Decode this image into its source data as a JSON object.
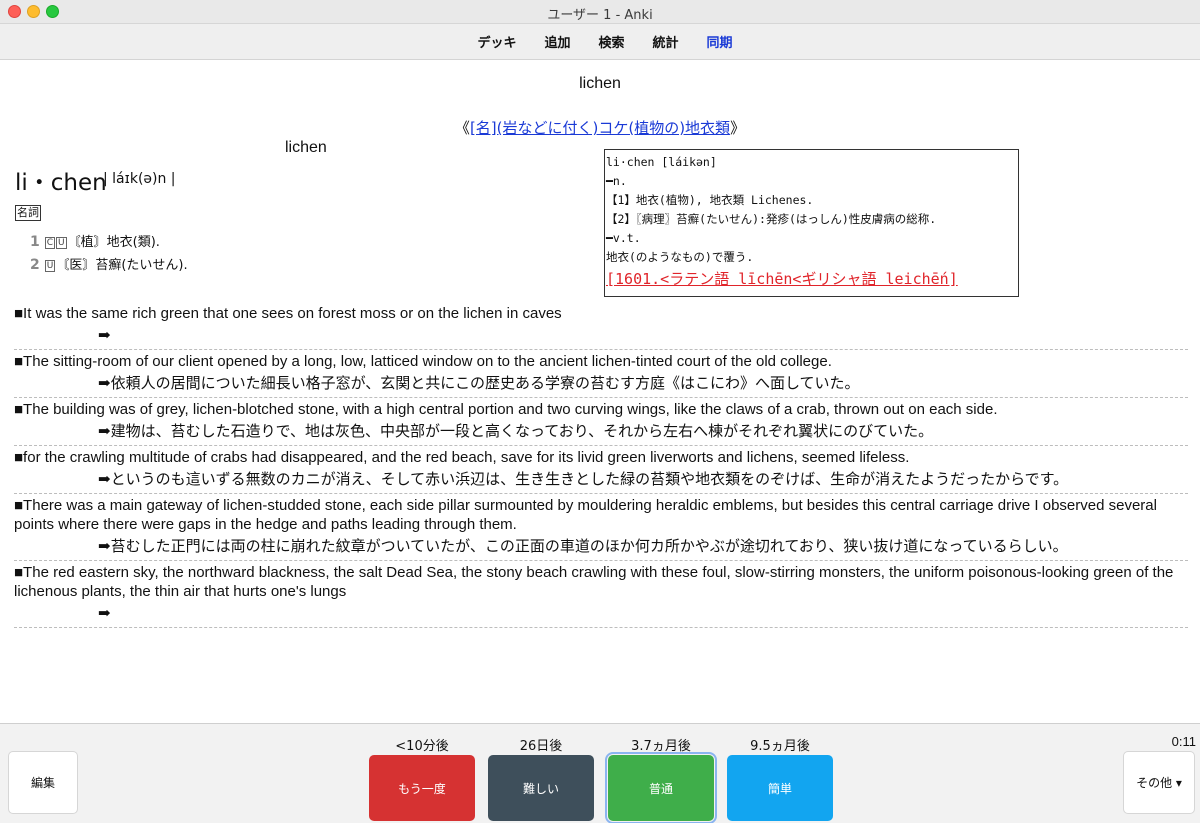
{
  "window": {
    "title": "ユーザー 1 - Anki"
  },
  "toolbar": {
    "decks": "デッキ",
    "add": "追加",
    "browse": "検索",
    "stats": "統計",
    "sync": "同期",
    "sync_color": "#1a3ad6"
  },
  "card": {
    "front": "lichen",
    "headline_open": "《",
    "headline_link": "[名](岩などに付く)コケ(植物の)地衣類",
    "headline_close": "》",
    "word_small": "lichen",
    "word_big": "li・chen",
    "pronunciation": "| láɪk(ə)n |",
    "pos": "名詞",
    "senses": [
      {
        "num": "1",
        "tags": [
          "C",
          "U"
        ],
        "text": "〘植〙地衣(類)."
      },
      {
        "num": "2",
        "tags": [
          "U"
        ],
        "text": "〘医〙苔癬(たいせん)."
      }
    ],
    "dict_lines": [
      "li·chen [láikən]",
      "━n.",
      "【1】地衣(植物), 地衣類 Lichenes.",
      "【2】〖病理〗苔癬(たいせん):発疹(はっしん)性皮膚病の総称.",
      "━v.t.",
      "地衣(のようなもの)で覆う."
    ],
    "dict_etymology": "[1601.<ラテン語 līchēn<ギリシャ語 leichḗn]",
    "dict_etymology_color": "#e0242a",
    "examples": [
      {
        "en": "■It was the same rich green that one sees on forest moss or on the lichen in caves",
        "ja": "➡"
      },
      {
        "en": "■The sitting-room of our client opened by a long, low, latticed window on to the ancient lichen-tinted court of the old college.",
        "ja": "➡依頼人の居間についた細長い格子窓が、玄関と共にこの歴史ある学寮の苔むす方庭《はこにわ》へ面していた。"
      },
      {
        "en": "■The building was of grey, lichen-blotched stone, with a high central portion and two curving wings, like the claws of a crab, thrown out on each side.",
        "ja": "➡建物は、苔むした石造りで、地は灰色、中央部が一段と高くなっており、それから左右へ棟がそれぞれ翼状にのびていた。"
      },
      {
        "en": "■for the crawling multitude of crabs had disappeared, and the red beach, save for its livid green liverworts and lichens, seemed lifeless.",
        "ja": "➡というのも這いずる無数のカニが消え、そして赤い浜辺は、生き生きとした緑の苔類や地衣類をのぞけば、生命が消えたようだったからです。"
      },
      {
        "en": "■There was a main gateway of lichen-studded stone, each side pillar surmounted by mouldering heraldic emblems, but besides this central carriage drive I observed several points where there were gaps in the hedge and paths leading through them.",
        "ja": "➡苔むした正門には両の柱に崩れた紋章がついていたが、この正面の車道のほか何カ所かやぶが途切れており、狭い抜け道になっているらしい。"
      },
      {
        "en": "■The red eastern sky, the northward blackness, the salt Dead Sea, the stony beach crawling with these foul, slow-stirring monsters, the uniform poisonous-looking green of the lichenous plants, the thin air that hurts one's lungs",
        "ja": "➡"
      }
    ]
  },
  "bottom": {
    "edit": "編集",
    "more": "その他 ▾",
    "timer": "0:11",
    "answers": [
      {
        "interval": "<10分後",
        "label": "もう一度",
        "color": "#d63232"
      },
      {
        "interval": "26日後",
        "label": "難しい",
        "color": "#3e4f5b"
      },
      {
        "interval": "3.7ヵ月後",
        "label": "普通",
        "color": "#3fae4a"
      },
      {
        "interval": "9.5ヵ月後",
        "label": "簡単",
        "color": "#12a5f0"
      }
    ]
  }
}
